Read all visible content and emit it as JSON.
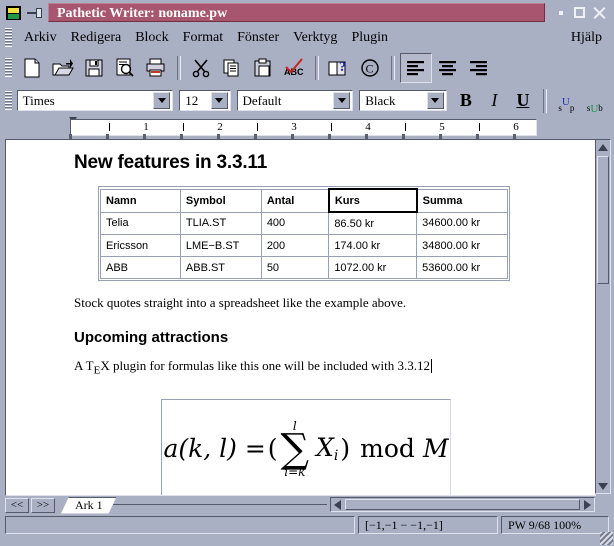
{
  "window": {
    "title": "Pathetic Writer: noname.pw",
    "app_icon": "app-icon",
    "pin_icon": "pin-icon",
    "minimize_label": "",
    "maximize_label": "",
    "close_label": ""
  },
  "menubar": {
    "items": [
      {
        "label": "Arkiv",
        "name": "menu-arkiv"
      },
      {
        "label": "Redigera",
        "name": "menu-redigera"
      },
      {
        "label": "Block",
        "name": "menu-block"
      },
      {
        "label": "Format",
        "name": "menu-format"
      },
      {
        "label": "Fönster",
        "name": "menu-fonster"
      },
      {
        "label": "Verktyg",
        "name": "menu-verktyg"
      },
      {
        "label": "Plugin",
        "name": "menu-plugin"
      }
    ],
    "help": "Hjälp"
  },
  "toolbar": {
    "buttons": [
      {
        "icon": "new-document-icon",
        "name": "new-button"
      },
      {
        "icon": "open-folder-icon",
        "name": "open-button"
      },
      {
        "icon": "save-floppy-icon",
        "name": "save-button"
      },
      {
        "icon": "print-preview-icon",
        "name": "print-preview-button"
      },
      {
        "icon": "printer-icon",
        "name": "print-button"
      },
      {
        "icon": "scissors-icon",
        "name": "cut-button"
      },
      {
        "icon": "copy-icon",
        "name": "copy-button"
      },
      {
        "icon": "paste-clipboard-icon",
        "name": "paste-button"
      },
      {
        "icon": "spellcheck-abc-icon",
        "name": "spellcheck-button"
      },
      {
        "icon": "help-book-icon",
        "name": "help-button"
      },
      {
        "icon": "copyright-icon",
        "name": "about-button"
      },
      {
        "icon": "align-left-icon",
        "name": "align-left-button"
      },
      {
        "icon": "align-center-icon",
        "name": "align-center-button"
      },
      {
        "icon": "align-right-icon",
        "name": "align-right-button"
      }
    ]
  },
  "formatbar": {
    "font_family": "Times",
    "font_size": "12",
    "style": "Default",
    "color": "Black",
    "bold_label": "B",
    "italic_label": "I",
    "underline_label": "U",
    "superscript_label": "sUp",
    "subscript_label": "sUb"
  },
  "ruler": {
    "numbers": [
      "1",
      "2",
      "3",
      "4",
      "5",
      "6"
    ]
  },
  "document": {
    "heading1": "New features in 3.3.11",
    "table": {
      "headers": [
        "Namn",
        "Symbol",
        "Antal",
        "Kurs",
        "Summa"
      ],
      "selected_header": "Kurs",
      "rows": [
        [
          "Telia",
          "TLIA.ST",
          "400",
          "86.50 kr",
          "34600.00 kr"
        ],
        [
          "Ericsson",
          "LME−B.ST",
          "200",
          "174.00 kr",
          "34800.00 kr"
        ],
        [
          "ABB",
          "ABB.ST",
          "50",
          "1072.00 kr",
          "53600.00 kr"
        ]
      ]
    },
    "paragraph1": "Stock quotes straight into a spreadsheet like the example above.",
    "heading2": "Upcoming attractions",
    "paragraph2_pre": "A T",
    "paragraph2_sub": "E",
    "paragraph2_post": "X plugin for formulas like this one will be included with 3.3.12",
    "formula": {
      "lhs": "a(k, l) =",
      "open_paren": "(",
      "sum_upper": "l",
      "sum_symbol": "∑",
      "sum_lower": "i=k",
      "term": "X",
      "term_sub": "i",
      "close_paren": ")",
      "mod": "mod",
      "modulus": "M",
      "alt_text": "a(k,l) = (sum from i=k to l of X_i) mod M"
    }
  },
  "tabs": {
    "prev_label": "<<",
    "next_label": ">>",
    "sheets": [
      {
        "label": "Ark 1",
        "active": true
      }
    ]
  },
  "statusbar": {
    "message": "",
    "selection": "[−1,−1 − −1,−1]",
    "info": "PW 9/68 100%"
  },
  "colors": {
    "window_face": "#aab0c4",
    "titlebar_active": "#a8566f",
    "titlebar_text": "#ffffff",
    "document_bg": "#ffffff",
    "grid_line": "#9aa0b4"
  }
}
